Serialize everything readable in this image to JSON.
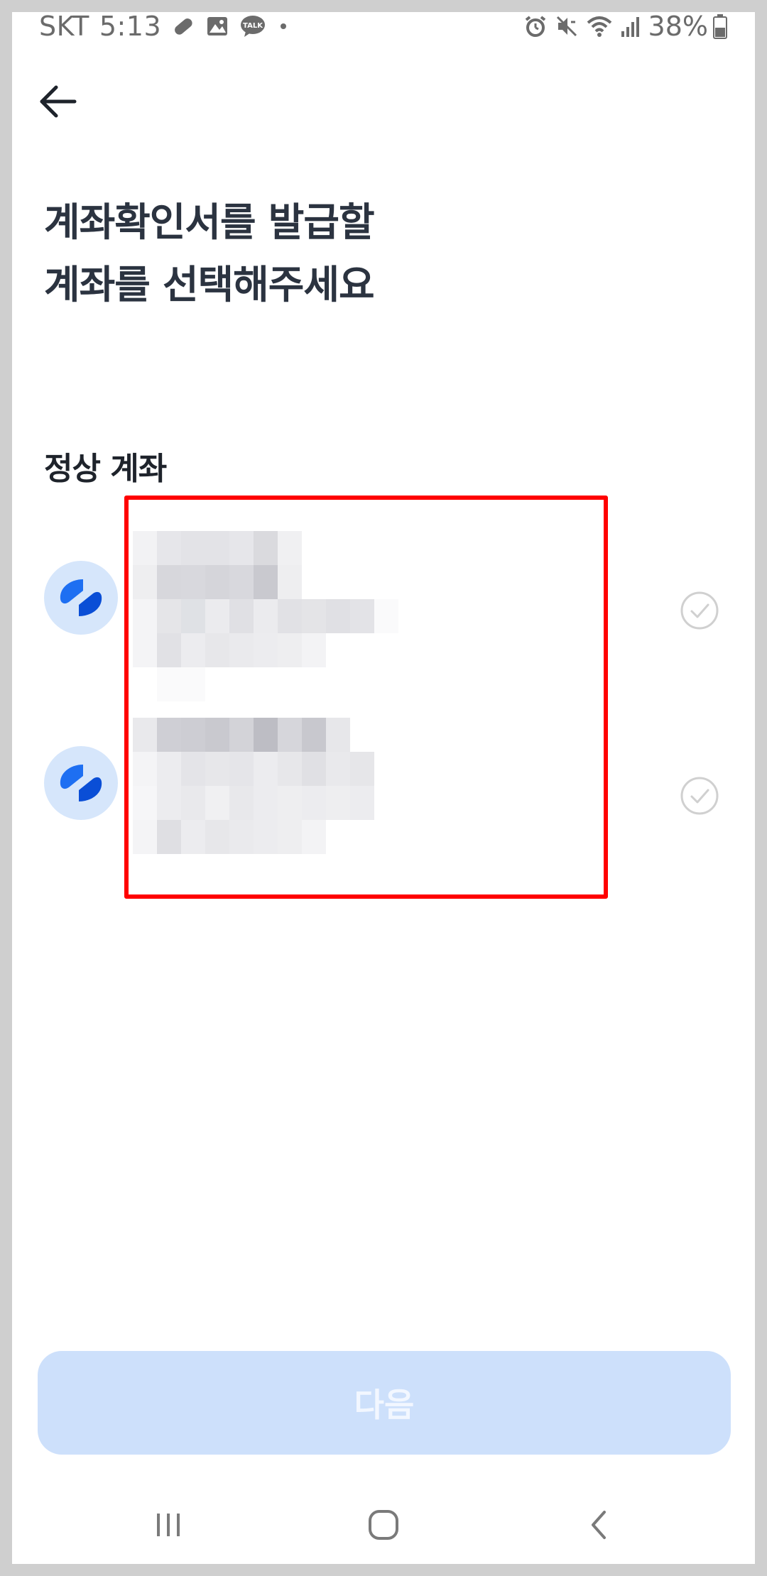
{
  "status_bar": {
    "carrier": "SKT",
    "time": "5:13",
    "left_icons": [
      "pill-icon",
      "image-icon",
      "talk-icon",
      "dot-icon"
    ],
    "talk_label": "TALK",
    "right_icons": [
      "alarm-icon",
      "mute-icon",
      "wifi-icon",
      "signal-icon",
      "battery-icon"
    ],
    "battery_percent": "38%"
  },
  "header": {
    "back_icon": "back-arrow-icon"
  },
  "title": {
    "line1": "계좌확인서를 발급할",
    "line2": "계좌를 선택해주세요"
  },
  "section": {
    "label": "정상 계좌"
  },
  "accounts": [
    {
      "logo_icon": "bank-logo-icon",
      "details": "redacted",
      "selected": false
    },
    {
      "logo_icon": "bank-logo-icon",
      "details": "redacted",
      "selected": false
    }
  ],
  "next_button": {
    "label": "다음",
    "enabled": false
  },
  "nav_bar": {
    "icons": [
      "recent-apps-icon",
      "home-icon",
      "nav-back-icon"
    ]
  },
  "colors": {
    "accent_logo": "#1e6ff2",
    "logo_bg": "#d6e6fb",
    "title_text": "#2b3340",
    "button_disabled_bg": "#cde0fb",
    "highlight_border": "#ff0000",
    "check_gray": "#d0d0d0"
  }
}
